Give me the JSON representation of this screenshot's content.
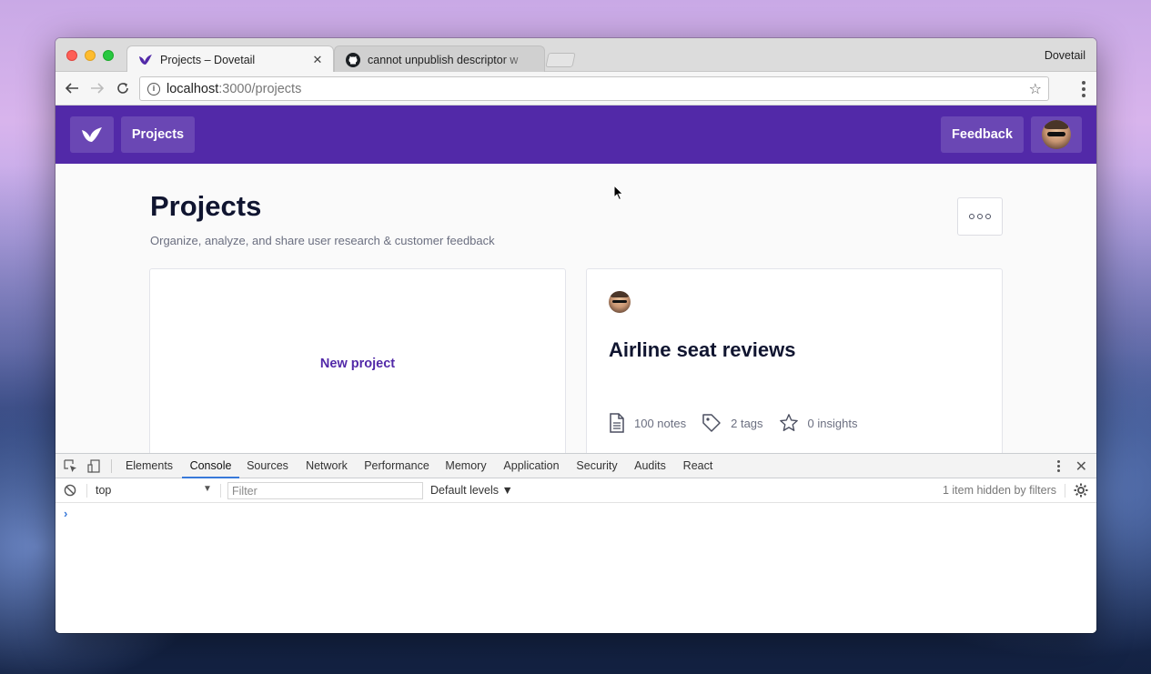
{
  "browser": {
    "profile_name": "Dovetail",
    "tabs": [
      {
        "title": "Projects – Dovetail",
        "close": "✕",
        "icon": "dovetail-bird-icon",
        "active": true
      },
      {
        "title": "cannot unpublish descriptor w",
        "icon": "github-icon",
        "active": false
      }
    ],
    "url_host": "localhost",
    "url_rest": ":3000/projects"
  },
  "app": {
    "nav_projects": "Projects",
    "feedback": "Feedback",
    "brand_color": "#5229a8"
  },
  "page": {
    "title": "Projects",
    "subtitle": "Organize, analyze, and share user research & customer feedback"
  },
  "cards": {
    "new_project": "New project",
    "project": {
      "title": "Airline seat reviews",
      "notes": "100 notes",
      "tags": "2 tags",
      "insights": "0 insights"
    }
  },
  "devtools": {
    "tabs": [
      "Elements",
      "Console",
      "Sources",
      "Network",
      "Performance",
      "Memory",
      "Application",
      "Security",
      "Audits",
      "React"
    ],
    "active_tab": "Console",
    "context": "top",
    "filter_placeholder": "Filter",
    "levels": "Default levels ▼",
    "hidden_note": "1 item hidden by filters",
    "prompt": "›"
  }
}
